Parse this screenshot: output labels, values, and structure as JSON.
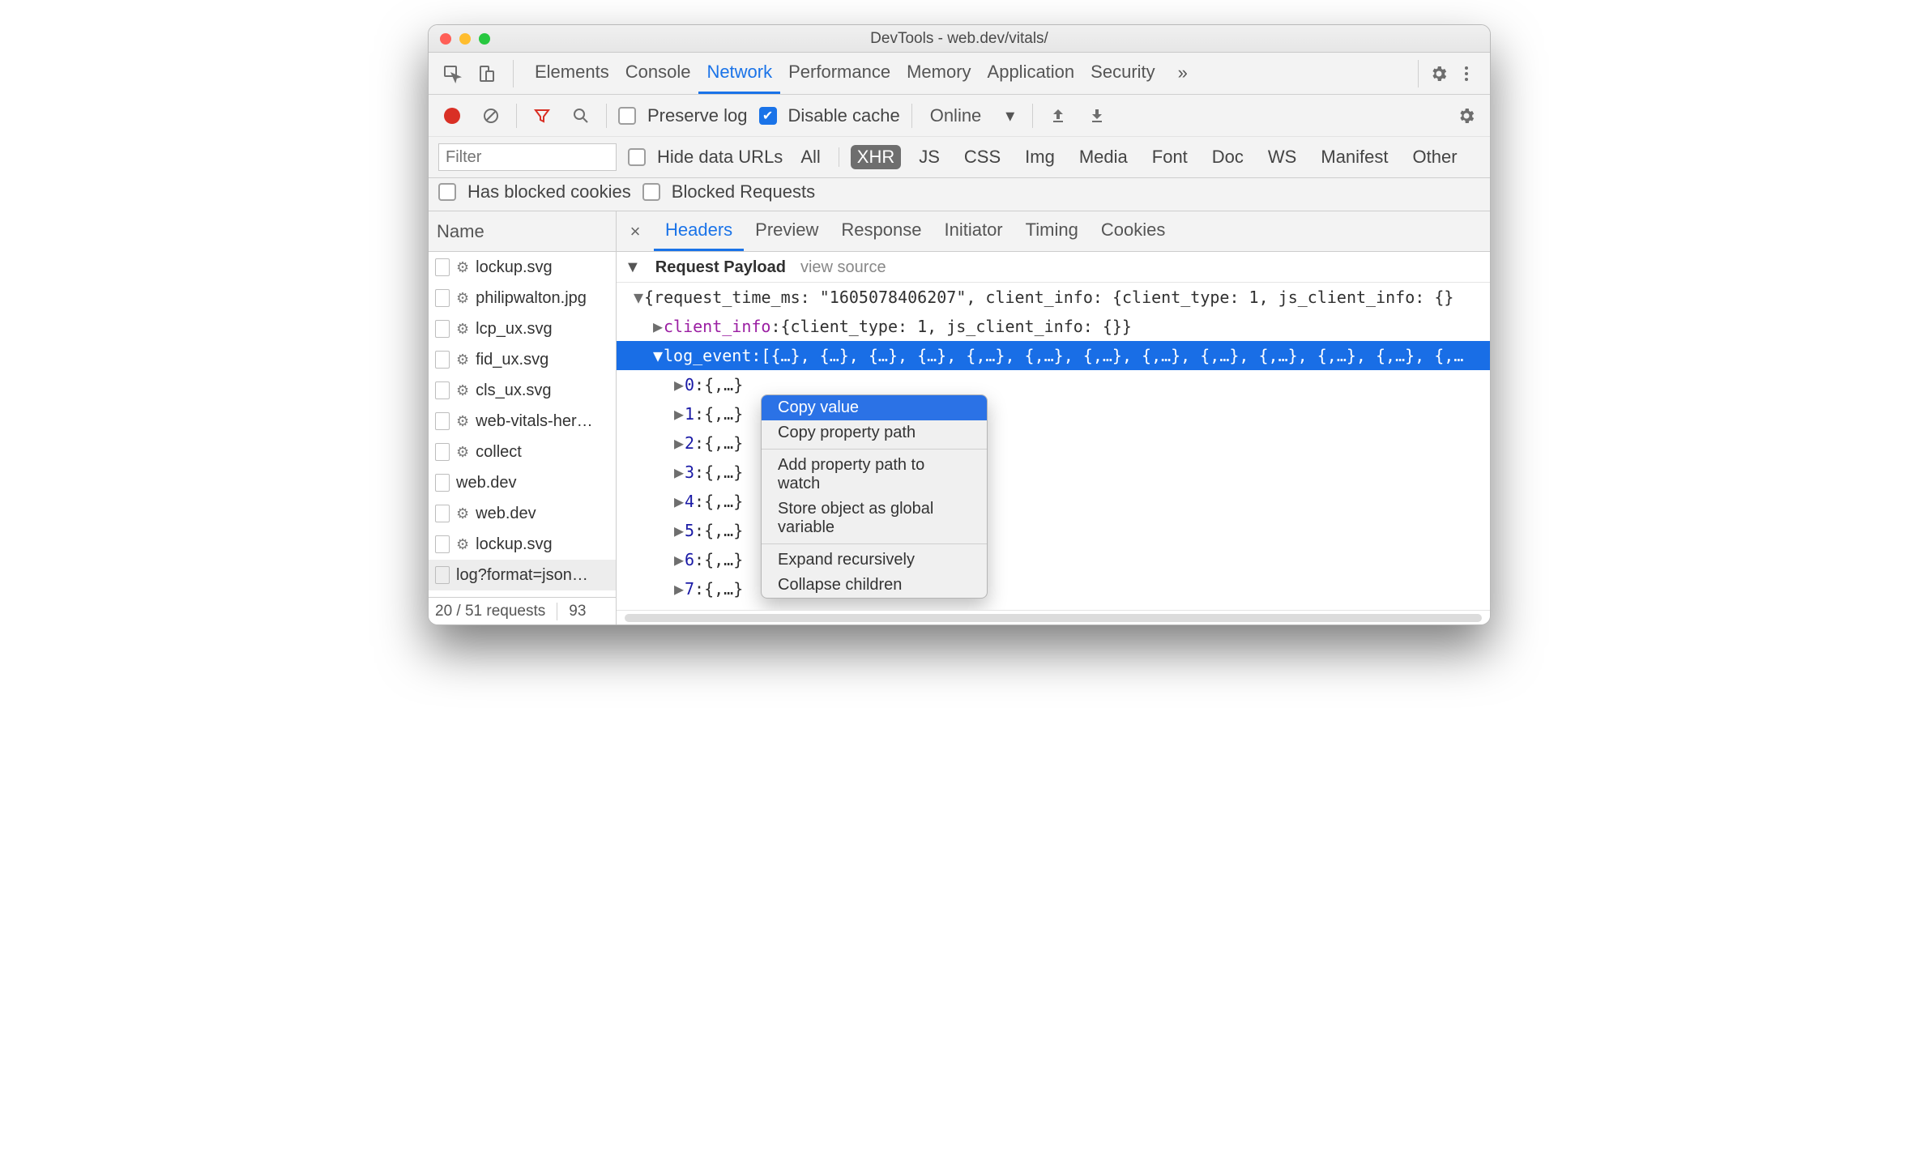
{
  "window_title": "DevTools - web.dev/vitals/",
  "panel_tabs": [
    "Elements",
    "Console",
    "Network",
    "Performance",
    "Memory",
    "Application",
    "Security"
  ],
  "active_panel_tab": "Network",
  "toolbar": {
    "preserve_log_label": "Preserve log",
    "preserve_log_checked": false,
    "disable_cache_label": "Disable cache",
    "disable_cache_checked": true,
    "throttle_label": "Online"
  },
  "filter": {
    "placeholder": "Filter",
    "hide_data_urls_label": "Hide data URLs",
    "hide_data_urls_checked": false,
    "types": [
      "All",
      "XHR",
      "JS",
      "CSS",
      "Img",
      "Media",
      "Font",
      "Doc",
      "WS",
      "Manifest",
      "Other"
    ],
    "active_type": "XHR",
    "has_blocked_cookies_label": "Has blocked cookies",
    "has_blocked_cookies_checked": false,
    "blocked_requests_label": "Blocked Requests",
    "blocked_requests_checked": false
  },
  "grid": {
    "name_header": "Name",
    "rows": [
      {
        "name": "lockup.svg",
        "gear": true
      },
      {
        "name": "philipwalton.jpg",
        "gear": true
      },
      {
        "name": "lcp_ux.svg",
        "gear": true
      },
      {
        "name": "fid_ux.svg",
        "gear": true
      },
      {
        "name": "cls_ux.svg",
        "gear": true
      },
      {
        "name": "web-vitals-her…",
        "gear": true
      },
      {
        "name": "collect",
        "gear": true
      },
      {
        "name": "web.dev",
        "gear": false
      },
      {
        "name": "web.dev",
        "gear": true
      },
      {
        "name": "lockup.svg",
        "gear": true
      },
      {
        "name": "log?format=json…",
        "gear": false,
        "selected": true
      }
    ],
    "status_requests": "20 / 51 requests",
    "status_extra": "93"
  },
  "detail": {
    "tabs": [
      "Headers",
      "Preview",
      "Response",
      "Initiator",
      "Timing",
      "Cookies"
    ],
    "active_tab": "Headers",
    "section_title": "Request Payload",
    "section_link": "view source",
    "root_preview": "{request_time_ms: \"1605078406207\", client_info: {client_type: 1, js_client_info: {}",
    "client_info_line": {
      "key": "client_info",
      "preview": "{client_type: 1, js_client_info: {}}"
    },
    "log_event_line": {
      "key": "log_event",
      "preview": "[{…}, {…}, {…}, {…}, {,…}, {,…}, {,…}, {,…}, {,…}, {,…}, {,…}, {,…}, {,…"
    },
    "log_event_children": [
      {
        "index": "0",
        "preview": "{,…}"
      },
      {
        "index": "1",
        "preview": "{,…}"
      },
      {
        "index": "2",
        "preview": "{,…}"
      },
      {
        "index": "3",
        "preview": "{,…}"
      },
      {
        "index": "4",
        "preview": "{,…}"
      },
      {
        "index": "5",
        "preview": "{,…}"
      },
      {
        "index": "6",
        "preview": "{,…}"
      },
      {
        "index": "7",
        "preview": "{,…}"
      }
    ]
  },
  "context_menu": {
    "items": [
      "Copy value",
      "Copy property path",
      "-",
      "Add property path to watch",
      "Store object as global variable",
      "-",
      "Expand recursively",
      "Collapse children"
    ],
    "highlighted": "Copy value"
  }
}
